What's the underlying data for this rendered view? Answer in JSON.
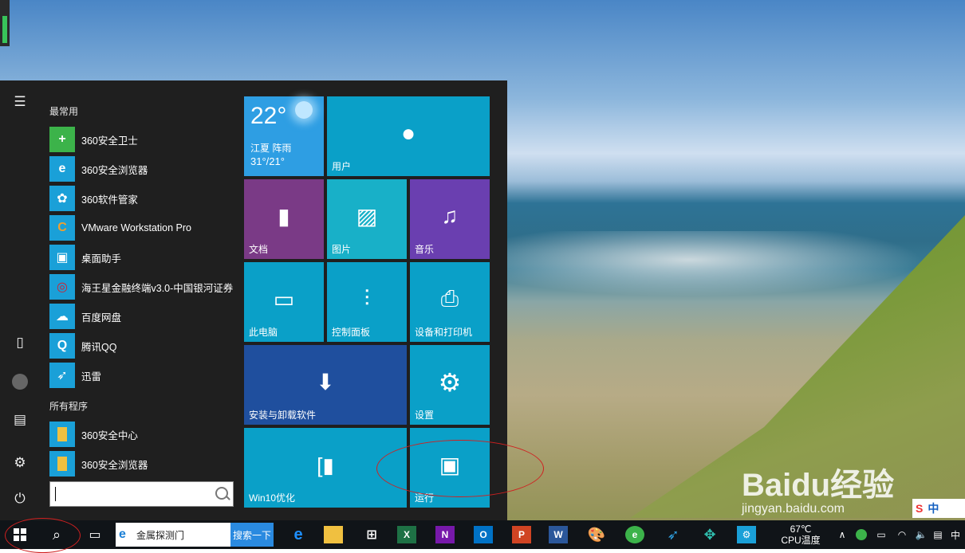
{
  "start_menu": {
    "most_used_header": "最常用",
    "all_programs_header": "所有程序",
    "most_used": [
      {
        "label": "360安全卫士",
        "icon": "360-safe-guard-icon",
        "color": "#3cb34a"
      },
      {
        "label": "360安全浏览器",
        "icon": "360-browser-icon",
        "color": "#3cb34a"
      },
      {
        "label": "360软件管家",
        "icon": "360-software-manager-icon",
        "color": "#3cb34a"
      },
      {
        "label": "VMware Workstation Pro",
        "icon": "vmware-icon",
        "color": "#1aa0d8"
      },
      {
        "label": "桌面助手",
        "icon": "desktop-assistant-icon",
        "color": "#1aa0d8"
      },
      {
        "label": "海王星金融终端v3.0-中国银河证券",
        "icon": "neptune-finance-icon",
        "color": "#1aa0d8"
      },
      {
        "label": "百度网盘",
        "icon": "baidu-netdisk-icon",
        "color": "#1aa0d8"
      },
      {
        "label": "腾讯QQ",
        "icon": "qq-icon",
        "color": "#1aa0d8"
      },
      {
        "label": "迅雷",
        "icon": "xunlei-icon",
        "color": "#1aa0d8"
      }
    ],
    "all_programs": [
      {
        "label": "360安全中心",
        "icon": "folder-icon",
        "color": "#1aa0d8"
      },
      {
        "label": "360安全浏览器",
        "icon": "folder-icon",
        "color": "#1aa0d8"
      }
    ],
    "tiles": {
      "weather": {
        "temp": "22°",
        "city": "江夏  阵雨",
        "range": "31°/21°"
      },
      "user": "用户",
      "documents": "文档",
      "pictures": "图片",
      "music": "音乐",
      "this_pc": "此电脑",
      "control_panel": "控制面板",
      "devices_printers": "设备和打印机",
      "install_uninstall": "安装与卸载软件",
      "settings": "设置",
      "win10_optimize": "Win10优化",
      "run": "运行"
    }
  },
  "taskbar": {
    "address_text": "金属探测门",
    "search_button": "搜索一下",
    "cpu_temp": "67℃",
    "cpu_label": "CPU温度",
    "ime": "中",
    "pinned": [
      "edge",
      "explorer",
      "store",
      "excel",
      "onenote",
      "outlook",
      "powerpoint",
      "word",
      "paint",
      "360-browser",
      "xunlei",
      "network-app",
      "settings"
    ]
  },
  "watermark": {
    "logo": "Bai经验",
    "url": "jingyan.baidu.com",
    "ime_badge": "中"
  },
  "colors": {
    "tile_teal": "#0aa0c8",
    "tile_purple": "#6b3a8e",
    "tile_violet": "#6a3fb0",
    "tile_navy": "#1f4f9e",
    "tile_teal2": "#1ab0c0",
    "start_bg": "#1f1f1f",
    "taskbar_bg": "#101418"
  }
}
